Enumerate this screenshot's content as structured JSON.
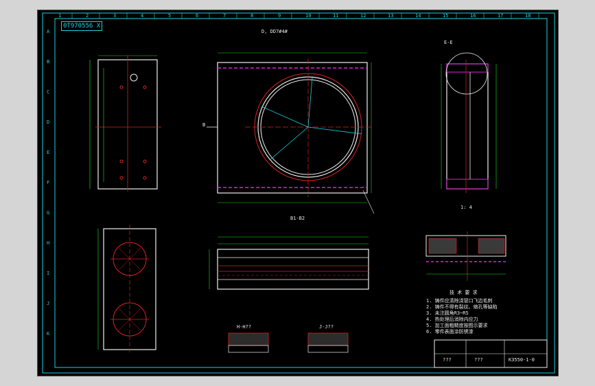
{
  "drawing": {
    "stamp_top_left": "0T970556 X",
    "column_markers": [
      "1",
      "2",
      "3",
      "4",
      "5",
      "6",
      "7",
      "8",
      "9",
      "10",
      "11",
      "12",
      "13",
      "14",
      "15",
      "16",
      "17",
      "18"
    ],
    "row_markers": [
      "A",
      "B",
      "C",
      "D",
      "E",
      "F",
      "G",
      "H",
      "I",
      "J",
      "K"
    ],
    "views": {
      "top_main": {
        "dimension": "D, DD7#4#",
        "section_mark_left": "B"
      },
      "right_section": {
        "title": "E-E"
      },
      "bottom_middle": {
        "title": "B1-B2"
      },
      "detail_left_title": "H-H??",
      "detail_right_title": "J-J??",
      "scale_note": "1: 4"
    },
    "notes_title": "技 术 要 求",
    "notes": [
      "1. 铸件应清除浇冒口飞边毛刺",
      "2. 铸件不得有裂纹、缩孔等缺陷",
      "3. 未注圆角R3~R5",
      "4. 热处理后消除内应力",
      "5. 加工面粗糙度按图示要求",
      "6. 零件表面涂防锈漆"
    ],
    "title_block": {
      "name": "???",
      "code": "K3550-1-0",
      "code2": "???"
    }
  },
  "colors": {
    "background": "#000000",
    "frame": "#18d4e0",
    "centerline": "#e02020",
    "hatch": "#e020e0",
    "text": "#e8e8e8",
    "dimension": "#20e020",
    "outline": "#f0f0f0"
  }
}
